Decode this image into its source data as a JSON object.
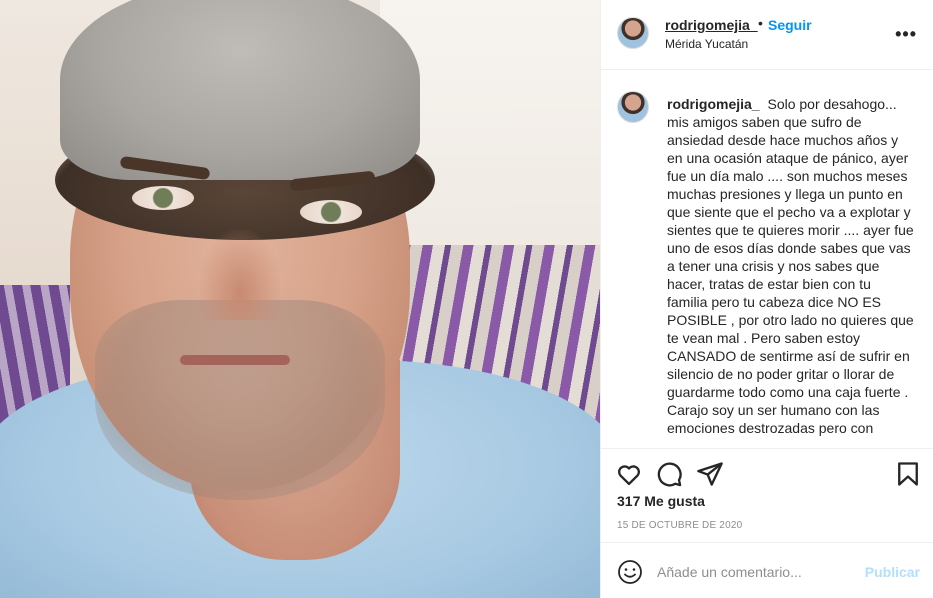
{
  "post": {
    "username": "rodrigomejia_",
    "follow_label": "Seguir",
    "separator": "•",
    "location": "Mérida Yucatán",
    "more_label": "•••"
  },
  "caption": {
    "username": "rodrigomejia_",
    "paragraph1": "Solo por desahogo... mis amigos saben que sufro de ansiedad desde hace muchos años y en una ocasión ataque de pánico, ayer fue un día malo .... son muchos meses muchas presiones y llega un punto en que siente que el pecho va a explotar y sientes que te quieres morir .... ayer fue uno de esos días donde sabes que vas a tener una crisis y nos sabes que hacer, tratas de estar bien con tu familia pero tu cabeza dice NO ES POSIBLE , por otro lado no quieres que te vean mal . Pero saben estoy CANSADO de sentirme así de sufrir en silencio de no poder gritar o llorar de guardarme todo como una caja fuerte .",
    "paragraph2": "Carajo soy un ser humano con las emociones destrozadas pero con"
  },
  "stats": {
    "likes": "317 Me gusta",
    "date": "15 DE OCTUBRE DE 2020"
  },
  "comment_box": {
    "placeholder": "Añade un comentario...",
    "publish_label": "Publicar"
  },
  "icons": {
    "like": "heart-icon",
    "comment": "comment-bubble-icon",
    "share": "paper-plane-icon",
    "save": "bookmark-icon",
    "emoji": "smiley-icon",
    "more": "more-options-icon"
  },
  "colors": {
    "accent": "#0095f6",
    "publish_disabled": "#b2dffc",
    "muted": "#8e8e8e",
    "text": "#262626",
    "divider": "#efefef"
  }
}
